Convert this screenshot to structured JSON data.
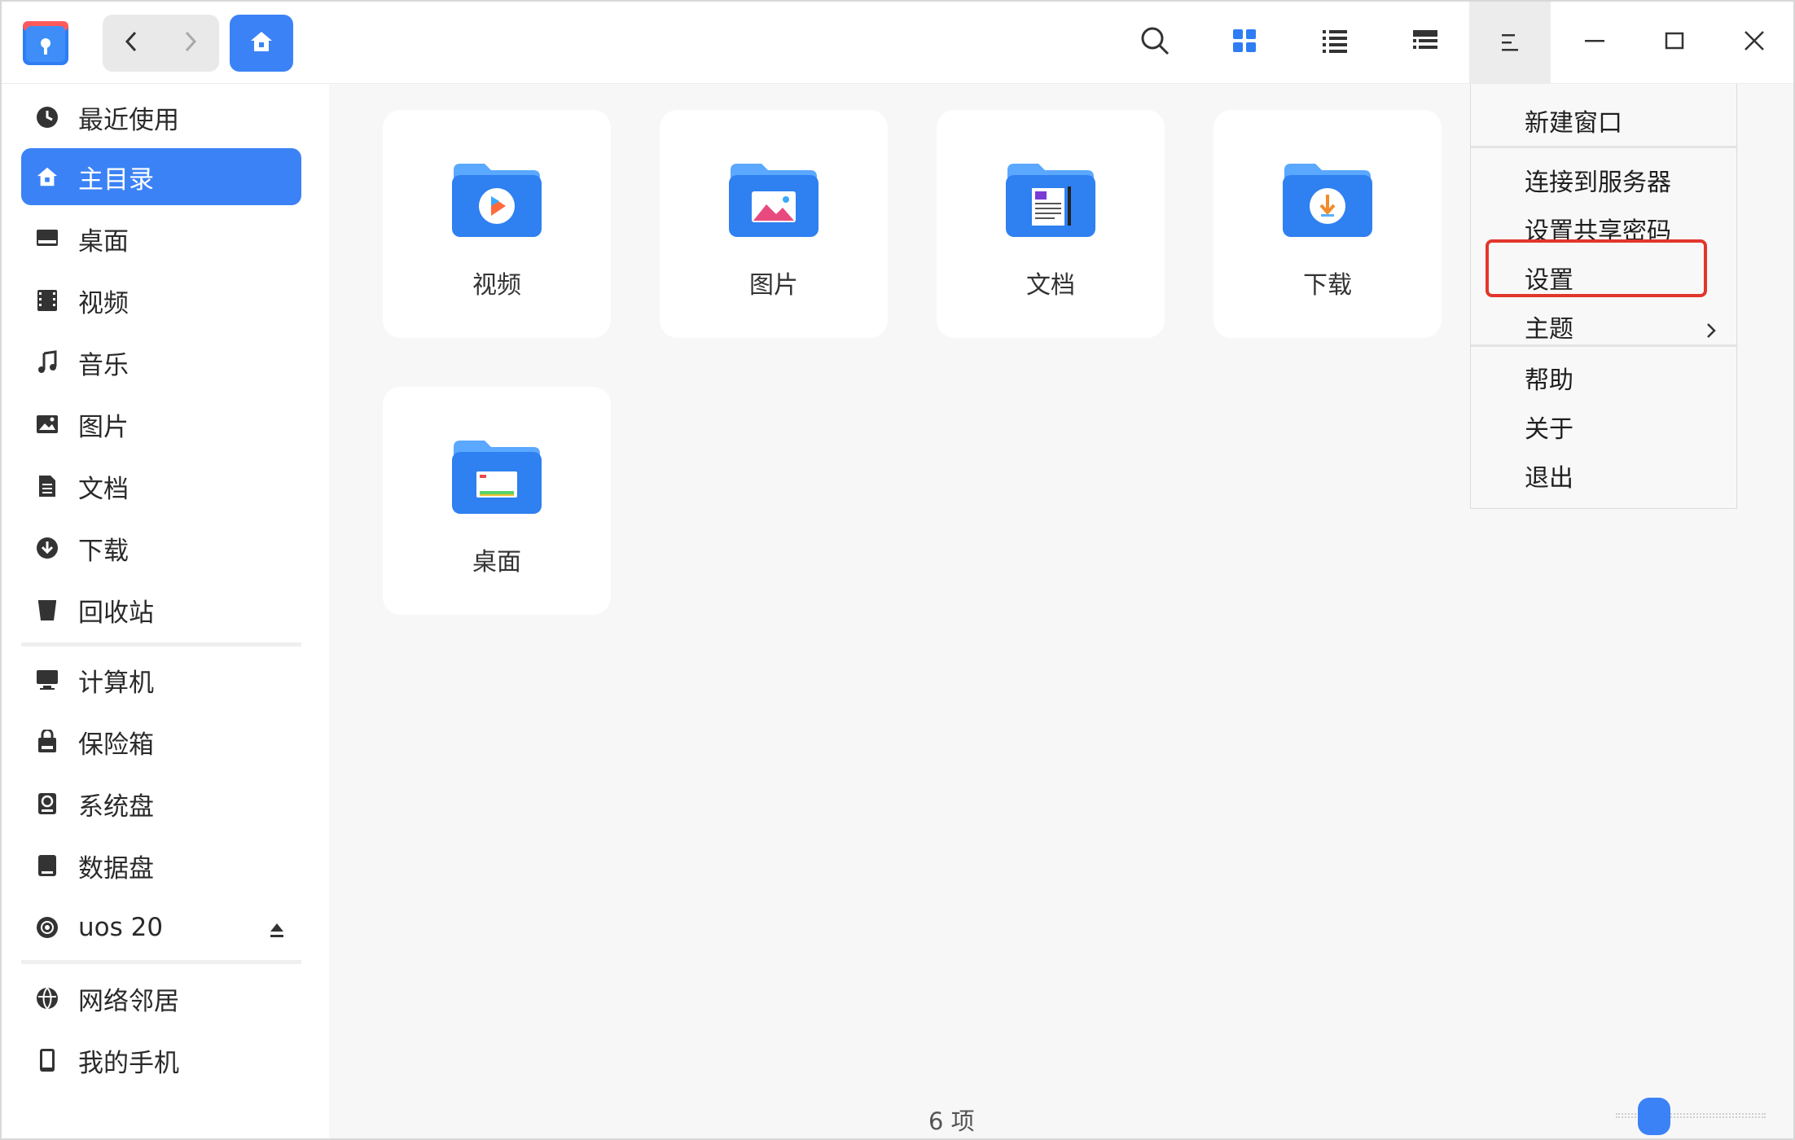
{
  "titlebar": {
    "logo_icon": "file-manager-logo-icon",
    "back_icon": "chevron-left-icon",
    "forward_icon": "chevron-right-icon",
    "home_icon": "home-icon",
    "toolbar_icons": [
      "search-icon",
      "grid-view-icon",
      "list-view-icon",
      "tree-view-icon",
      "menu-icon",
      "minimize-icon",
      "maximize-icon",
      "close-icon"
    ],
    "accent": "#3b82f6"
  },
  "sidebar": {
    "items": [
      {
        "label": "最近使用",
        "icon": "clock-icon"
      },
      {
        "label": "主目录",
        "icon": "home-icon",
        "active": true
      },
      {
        "label": "桌面",
        "icon": "desktop-icon"
      },
      {
        "label": "视频",
        "icon": "film-icon"
      },
      {
        "label": "音乐",
        "icon": "music-note-icon"
      },
      {
        "label": "图片",
        "icon": "picture-icon"
      },
      {
        "label": "文档",
        "icon": "document-icon"
      },
      {
        "label": "下载",
        "icon": "download-icon"
      },
      {
        "label": "回收站",
        "icon": "trash-icon"
      },
      {
        "label": "计算机",
        "icon": "computer-icon"
      },
      {
        "label": "保险箱",
        "icon": "safe-icon"
      },
      {
        "label": "系统盘",
        "icon": "system-disk-icon"
      },
      {
        "label": "数据盘",
        "icon": "data-disk-icon"
      },
      {
        "label": "uos 20",
        "icon": "optical-disc-icon",
        "eject_icon": "eject-icon"
      },
      {
        "label": "网络邻居",
        "icon": "network-icon"
      },
      {
        "label": "我的手机",
        "icon": "phone-icon"
      }
    ]
  },
  "main": {
    "folders": [
      {
        "label": "视频",
        "icon": "video-folder-icon"
      },
      {
        "label": "图片",
        "icon": "pictures-folder-icon"
      },
      {
        "label": "文档",
        "icon": "documents-folder-icon"
      },
      {
        "label": "下载",
        "icon": "downloads-folder-icon"
      },
      {
        "label": "桌面",
        "icon": "desktop-folder-icon"
      }
    ],
    "status": "6 项",
    "zoom_level": 0.2
  },
  "menu": {
    "items": [
      "新建窗口",
      "连接到服务器",
      "设置共享密码",
      "设置",
      "主题",
      "帮助",
      "关于",
      "退出"
    ],
    "highlighted": "设置",
    "highlight_color": "#e2362b",
    "submenu_icon": "chevron-right-icon"
  }
}
